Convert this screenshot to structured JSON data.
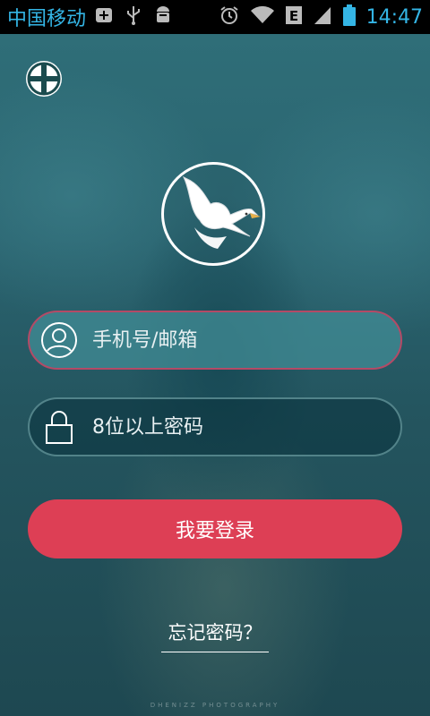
{
  "status_bar": {
    "carrier": "中国移动",
    "network_type": "E",
    "time": "14:47",
    "icons_left": [
      "add-notification-icon",
      "usb-icon",
      "android-debug-icon"
    ],
    "icons_right": [
      "alarm-icon",
      "wifi-icon",
      "network-type-icon",
      "signal-icon",
      "battery-icon"
    ]
  },
  "header": {
    "add_icon": "plus-circle-icon"
  },
  "avatar": {
    "icon": "dove-icon"
  },
  "login_form": {
    "username": {
      "placeholder": "手机号/邮箱",
      "value": "",
      "icon": "user-icon"
    },
    "password": {
      "placeholder": "8位以上密码",
      "value": "",
      "icon": "lock-icon"
    },
    "submit_label": "我要登录",
    "forgot_label": "忘记密码？"
  },
  "watermark": "DHENIZZ PHOTOGRAPHY",
  "colors": {
    "accent_status": "#34b5e5",
    "login_button": "#dd3f55",
    "username_border": "#b44a66",
    "background": "#2a6470"
  }
}
